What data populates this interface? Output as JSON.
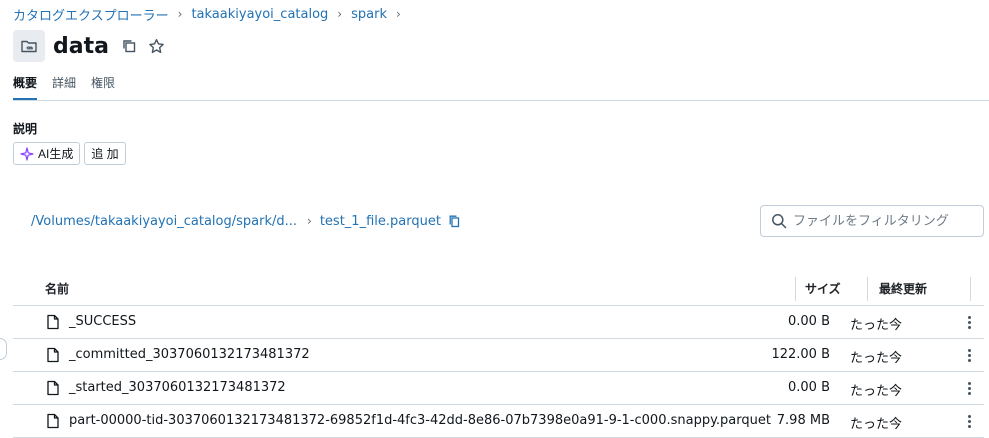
{
  "breadcrumb": [
    {
      "label": "カタログエクスプローラー"
    },
    {
      "label": "takaakiyayoi_catalog"
    },
    {
      "label": "spark"
    }
  ],
  "page": {
    "title": "data"
  },
  "tabs": [
    {
      "label": "概要",
      "active": true
    },
    {
      "label": "詳細",
      "active": false
    },
    {
      "label": "権限",
      "active": false
    }
  ],
  "description": {
    "label": "説明",
    "ai_button": "AI生成",
    "add_button": "追 加"
  },
  "path": {
    "folder": "/Volumes/takaakiyayoi_catalog/spark/d...",
    "file": "test_1_file.parquet"
  },
  "filter": {
    "placeholder": "ファイルをフィルタリング",
    "value": ""
  },
  "table": {
    "headers": {
      "name": "名前",
      "size": "サイズ",
      "modified": "最終更新"
    },
    "rows": [
      {
        "name": "_SUCCESS",
        "size": "0.00 B",
        "modified": "たった今"
      },
      {
        "name": "_committed_3037060132173481372",
        "size": "122.00 B",
        "modified": "たった今"
      },
      {
        "name": "_started_3037060132173481372",
        "size": "0.00 B",
        "modified": "たった今"
      },
      {
        "name": "part-00000-tid-3037060132173481372-69852f1d-4fc3-42dd-8e86-07b7398e0a91-9-1-c000.snappy.parquet",
        "size": "7.98 MB",
        "modified": "たった今"
      }
    ]
  },
  "colors": {
    "link": "#2272b4",
    "text": "#11171c",
    "border": "#d1d9e1",
    "ai_accent": "#8a3ffc"
  },
  "icons": [
    "volume-folder-icon",
    "copy-icon",
    "star-icon",
    "sparkle-icon",
    "search-icon",
    "file-icon",
    "kebab-menu-icon"
  ]
}
